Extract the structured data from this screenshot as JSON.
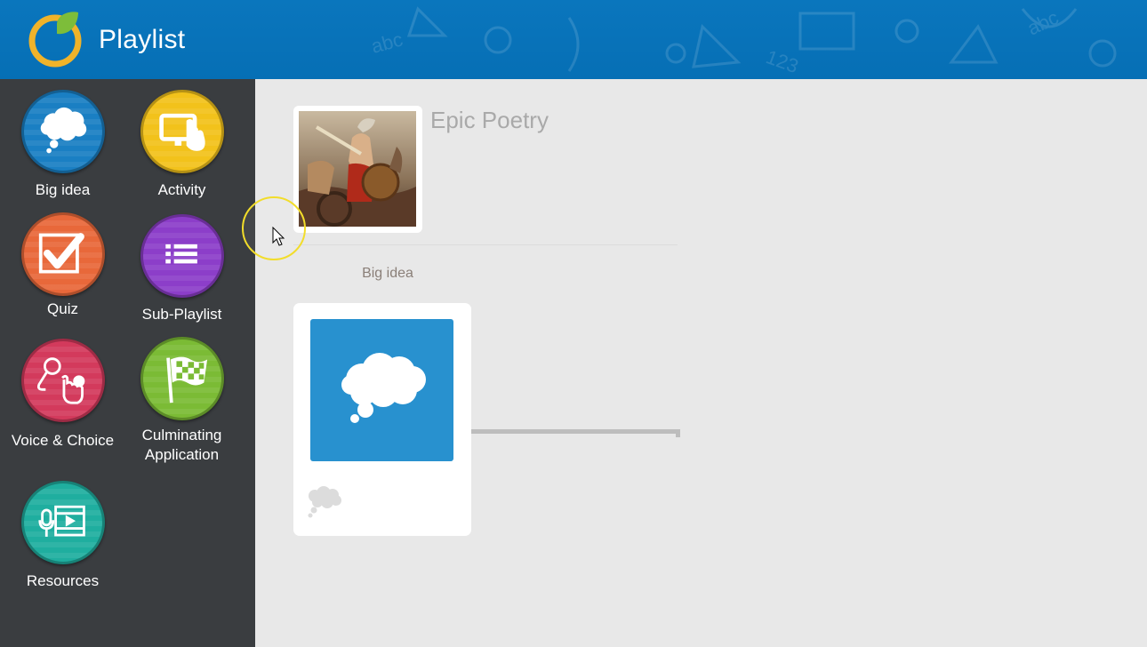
{
  "header": {
    "title": "Playlist",
    "logo_icon": "logo-ring-leaf-icon",
    "colors": {
      "background": "#0a76bd",
      "logo_ring": "#f0b32a",
      "logo_leaf": "#7dbd3a"
    }
  },
  "sidebar": {
    "tools": [
      {
        "label": "Big idea",
        "icon": "thought-bubble-icon",
        "color": "#1a7fc3"
      },
      {
        "label": "Activity",
        "icon": "touch-screen-icon",
        "color": "#f2c21b"
      },
      {
        "label": "Quiz",
        "icon": "checkbox-checked-icon",
        "color": "#e8683a"
      },
      {
        "label": "Sub-Playlist",
        "icon": "list-icon",
        "color": "#8c3ec9"
      },
      {
        "label": "Voice & Choice",
        "icon": "microphone-tap-icon",
        "color": "#d33a5c"
      },
      {
        "label": "Culminating Application",
        "icon": "checkered-flag-icon",
        "color": "#7bbb35"
      },
      {
        "label": "Resources",
        "icon": "media-resources-icon",
        "color": "#1fae9f"
      }
    ]
  },
  "main": {
    "playlist_title": "Epic Poetry",
    "cover_icon": "epic-poetry-painting",
    "section_label": "Big idea",
    "item": {
      "tile_icon": "thought-bubble-icon",
      "type_icon": "small-thought-bubble-icon",
      "tile_color": "#2891cf"
    }
  }
}
